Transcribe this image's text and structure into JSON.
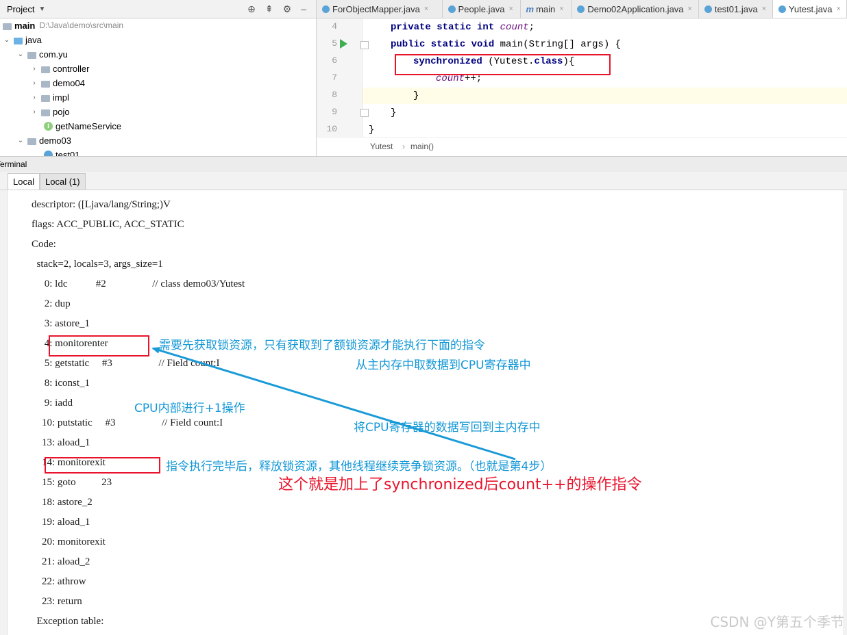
{
  "project_panel": {
    "title": "Project",
    "tree": [
      {
        "label": "main",
        "hint": "D:\\Java\\demo\\src\\main"
      },
      {
        "label": "java"
      },
      {
        "label": "com.yu"
      },
      {
        "label": "controller"
      },
      {
        "label": "demo04"
      },
      {
        "label": "impl"
      },
      {
        "label": "pojo"
      },
      {
        "label": "getNameService",
        "icon_letter": "I"
      },
      {
        "label": "demo03"
      },
      {
        "label": "test01"
      }
    ]
  },
  "editor": {
    "tabs": [
      {
        "label": "ForObjectMapper.java"
      },
      {
        "label": "People.java"
      },
      {
        "label": "main",
        "icon": "m"
      },
      {
        "label": "Demo02Application.java"
      },
      {
        "label": "test01.java"
      },
      {
        "label": "Yutest.java"
      }
    ],
    "line_numbers": [
      "4",
      "5",
      "6",
      "7",
      "8",
      "9",
      "10"
    ],
    "code": {
      "l4_kw": "private static int",
      "l4_field": "count",
      "l4_end": ";",
      "l5_kw": "public static void",
      "l5_rest": "main(String[] args) {",
      "l6_kw": "synchronized",
      "l6_mid": "(Yutest.",
      "l6_kw2": "class",
      "l6_end": "){",
      "l7_field": "count",
      "l7_end": "++;",
      "l8": "}",
      "l9": "}",
      "l10": "}"
    },
    "breadcrumbs": [
      "Yutest",
      "main()"
    ]
  },
  "terminal": {
    "title": "Terminal",
    "tabs": [
      "Local",
      "Local (1)"
    ],
    "lines": [
      "descriptor: ([Ljava/lang/String;)V",
      "flags: ACC_PUBLIC, ACC_STATIC",
      "Code:",
      "  stack=2, locals=3, args_size=1",
      "     0: ldc           #2                  // class demo03/Yutest",
      "     2: dup",
      "     3: astore_1",
      "     4: monitorenter",
      "     5: getstatic     #3                  // Field count:I",
      "     8: iconst_1",
      "     9: iadd",
      "    10: putstatic     #3                  // Field count:I",
      "    13: aload_1",
      "    14: monitorexit",
      "    15: goto          23",
      "    18: astore_2",
      "    19: aload_1",
      "    20: monitorexit",
      "    21: aload_2",
      "    22: athrow",
      "    23: return",
      "  Exception table:"
    ]
  },
  "annotations": {
    "monitorenter_note": "需要先获取锁资源，只有获取到了额锁资源才能执行下面的指令",
    "getstatic_note": "从主内存中取数据到CPU寄存器中",
    "iadd_note": "CPU内部进行+1操作",
    "putstatic_note": "将CPU寄存器的数据写回到主内存中",
    "monitorexit_note": "指令执行完毕后，释放锁资源，其他线程继续竞争锁资源。（也就是第4步）",
    "summary": "这个就是加上了synchronized后count++的操作指令"
  },
  "colors": {
    "annotation_box": "#e8142c",
    "annotation_text": "#1297d6",
    "arrow": "#1a9bd8"
  },
  "watermark": "CSDN @Y第五个季节"
}
